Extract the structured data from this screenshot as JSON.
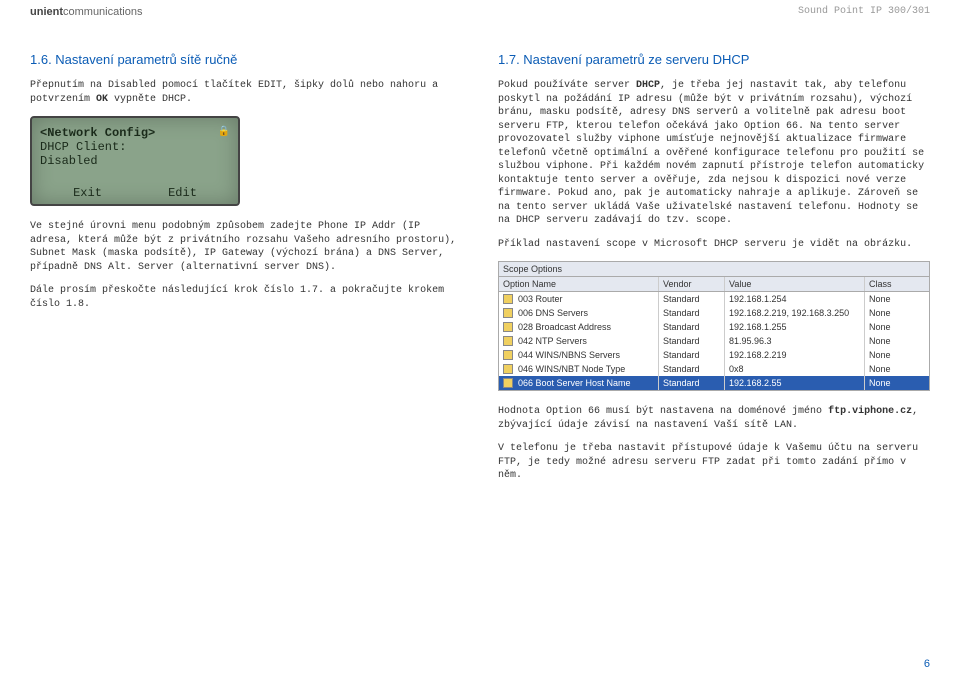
{
  "header": {
    "logo_bold": "unient",
    "logo_light": "communications",
    "model": "Sound Point IP 300/301"
  },
  "left": {
    "heading": "1.6. Nastavení parametrů sítě ručně",
    "p1_a": "Přepnutím na Disabled pomocí tlačítek EDIT, šipky dolů nebo nahoru a potvrzením ",
    "p1_b": "OK",
    "p1_c": " vypněte DHCP.",
    "lcd": {
      "title": "<Network Config>",
      "line1": "DHCP Client:",
      "line2": "Disabled",
      "btn_left": "Exit",
      "btn_right": "Edit"
    },
    "p2": "Ve stejné úrovni menu podobným způsobem zadejte Phone IP Addr (IP adresa, která může být z privátního rozsahu Vašeho adresního prostoru), Subnet Mask (maska podsítě), IP Gateway (výchozí brána) a DNS Server, případně DNS Alt. Server (alternativní server DNS).",
    "p3": "Dále prosím přeskočte následující krok číslo 1.7. a pokračujte krokem číslo 1.8."
  },
  "right": {
    "heading": "1.7. Nastavení parametrů ze serveru DHCP",
    "p1_a": "Pokud používáte server ",
    "p1_b": "DHCP",
    "p1_c": ", je třeba jej nastavit tak, aby telefonu poskytl na požádání IP adresu (může být v privátním rozsahu), výchozí bránu, masku podsítě, adresy DNS serverů a volitelně pak adresu boot serveru FTP, kterou telefon očekává jako Option 66. Na tento server provozovatel služby viphone umísťuje nejnovější aktualizace firmware telefonů včetně optimální a ověřené konfigurace telefonu pro použití se službou viphone. Při každém novém zapnutí přístroje telefon automaticky kontaktuje tento server a ověřuje, zda nejsou k dispozici nové verze firmware. Pokud ano, pak je automaticky nahraje a aplikuje. Zároveň se na tento server ukládá Vaše uživatelské nastavení telefonu. Hodnoty se na DHCP serveru zadávají do tzv. scope.",
    "p2": "Příklad nastavení scope v Microsoft DHCP serveru je vidět na obrázku.",
    "scope": {
      "title": "Scope Options",
      "headers": {
        "c1": "Option Name",
        "c2": "Vendor",
        "c3": "Value",
        "c4": "Class"
      },
      "rows": [
        {
          "name": "003 Router",
          "vendor": "Standard",
          "value": "192.168.1.254",
          "cls": "None"
        },
        {
          "name": "006 DNS Servers",
          "vendor": "Standard",
          "value": "192.168.2.219, 192.168.3.250",
          "cls": "None"
        },
        {
          "name": "028 Broadcast Address",
          "vendor": "Standard",
          "value": "192.168.1.255",
          "cls": "None"
        },
        {
          "name": "042 NTP Servers",
          "vendor": "Standard",
          "value": "81.95.96.3",
          "cls": "None"
        },
        {
          "name": "044 WINS/NBNS Servers",
          "vendor": "Standard",
          "value": "192.168.2.219",
          "cls": "None"
        },
        {
          "name": "046 WINS/NBT Node Type",
          "vendor": "Standard",
          "value": "0x8",
          "cls": "None"
        },
        {
          "name": "066 Boot Server Host Name",
          "vendor": "Standard",
          "value": "192.168.2.55",
          "cls": "None"
        }
      ]
    },
    "p3_a": "Hodnota Option 66 musí být nastavena na doménové jméno ",
    "p3_b": "ftp.viphone.cz",
    "p3_c": ", zbývající údaje závisí na nastavení Vaší sítě LAN.",
    "p4": "V telefonu je třeba nastavit přístupové údaje k Vašemu účtu na serveru FTP, je tedy možné adresu serveru FTP zadat při tomto zadání přímo v něm."
  },
  "page_number": "6"
}
